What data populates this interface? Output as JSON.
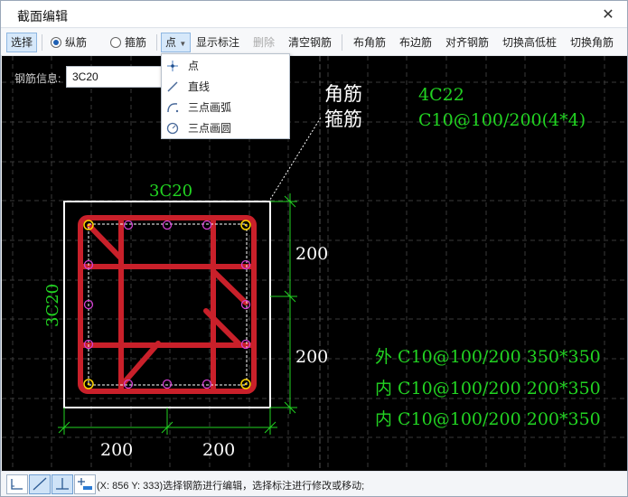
{
  "window": {
    "title": "截面编辑",
    "close_glyph": "✕"
  },
  "toolbar": {
    "select": "选择",
    "longitudinal": "纵筋",
    "stirrup": "箍筋",
    "point": "点",
    "show_annotation": "显示标注",
    "delete": "删除",
    "clear_rebar": "清空钢筋",
    "corner_rebar": "布角筋",
    "side_rebar": "布边筋",
    "align_rebar": "对齐钢筋",
    "toggle_pile": "切换高低桩",
    "toggle_corner": "切换角筋"
  },
  "rebar_info": {
    "label": "钢筋信息:",
    "value": "3C20"
  },
  "draw_menu": {
    "items": [
      "点",
      "直线",
      "三点画弧",
      "三点画圆"
    ]
  },
  "drawing": {
    "corner_label": "角筋",
    "stirrup_label": "箍筋",
    "corner_value": "4C22",
    "stirrup_value": "C10@100/200(4*4)",
    "top_label": "3C20",
    "left_label": "3C20",
    "dim_right_top": "200",
    "dim_right_bottom": "200",
    "dim_bottom_left": "200",
    "dim_bottom_right": "200",
    "stirrup_outer": "外 C10@100/200 350*350",
    "stirrup_inner1": "内 C10@100/200 200*350",
    "stirrup_inner2": "内 C10@100/200 200*350",
    "colors": {
      "green": "#22d422",
      "white": "#ffffff",
      "rebar": "#c9202a",
      "corner_bar": "#ffd400",
      "side_bar": "#d33fd3"
    }
  },
  "status": {
    "text": "(X: 856 Y: 333)选择钢筋进行编辑，选择标注进行修改或移动;"
  }
}
